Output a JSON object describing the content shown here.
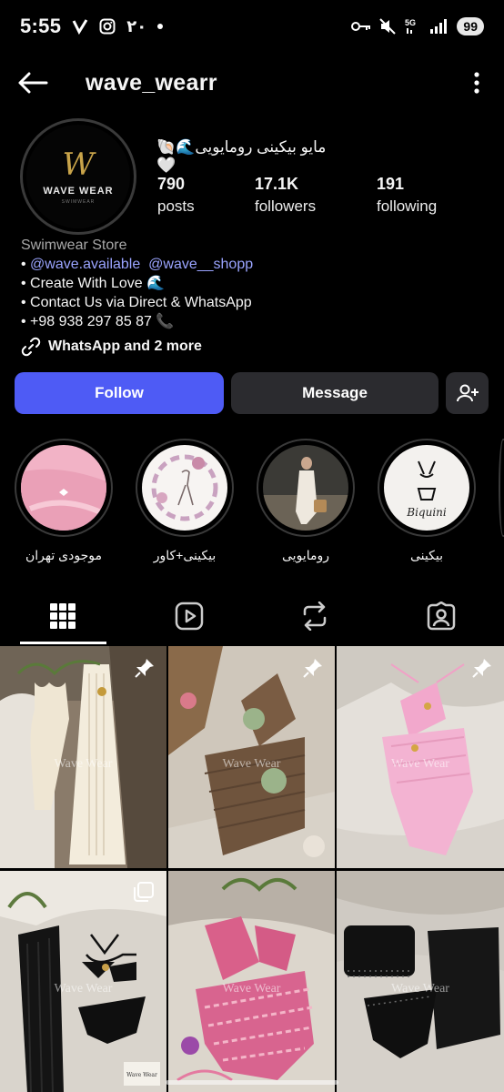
{
  "status_bar": {
    "time": "5:55",
    "extra_text": "۲۰",
    "battery": "99",
    "network": "5G"
  },
  "header": {
    "username": "wave_wearr"
  },
  "profile": {
    "full_name": "مایو بیکینی رومایویی🌊🐚🤍",
    "avatar_brand": "WAVE WEAR",
    "avatar_monogram": "W",
    "avatar_sub": "SWIMWEAR",
    "stats": [
      {
        "value": "790",
        "label": "posts"
      },
      {
        "value": "17.1K",
        "label": "followers"
      },
      {
        "value": "191",
        "label": "following"
      }
    ],
    "category": "Swimwear Store",
    "bio_prefix": "• ",
    "mention_1": "@wave.available",
    "mention_2": "@wave__shopp",
    "bio_line_2": "• Create With Love 🌊",
    "bio_line_3": "• Contact Us via Direct & WhatsApp",
    "bio_line_4": "• +98 938 297 85 87 📞",
    "links_text": "WhatsApp and 2 more"
  },
  "actions": {
    "follow": "Follow",
    "message": "Message"
  },
  "highlights": [
    {
      "label": "موجودی تهران"
    },
    {
      "label": "بیکینی+کاور"
    },
    {
      "label": "رومایویی"
    },
    {
      "label": "بیکینی",
      "image_text": "Biquini"
    }
  ],
  "posts": [
    {
      "watermark": "Wave Wear",
      "badge": "pin"
    },
    {
      "watermark": "Wave Wear",
      "badge": "pin"
    },
    {
      "watermark": "Wave Wear",
      "badge": "pin"
    },
    {
      "watermark": "Wave Wear",
      "badge": "multi",
      "tag": "Wave Wear"
    },
    {
      "watermark": "Wave Wear",
      "badge": "none"
    },
    {
      "watermark": "Wave Wear",
      "badge": "none"
    }
  ],
  "colors": {
    "follow_button": "#4e5bf5",
    "secondary_button": "#2b2b2f",
    "mention": "#9aa4ff",
    "background": "#000000"
  }
}
